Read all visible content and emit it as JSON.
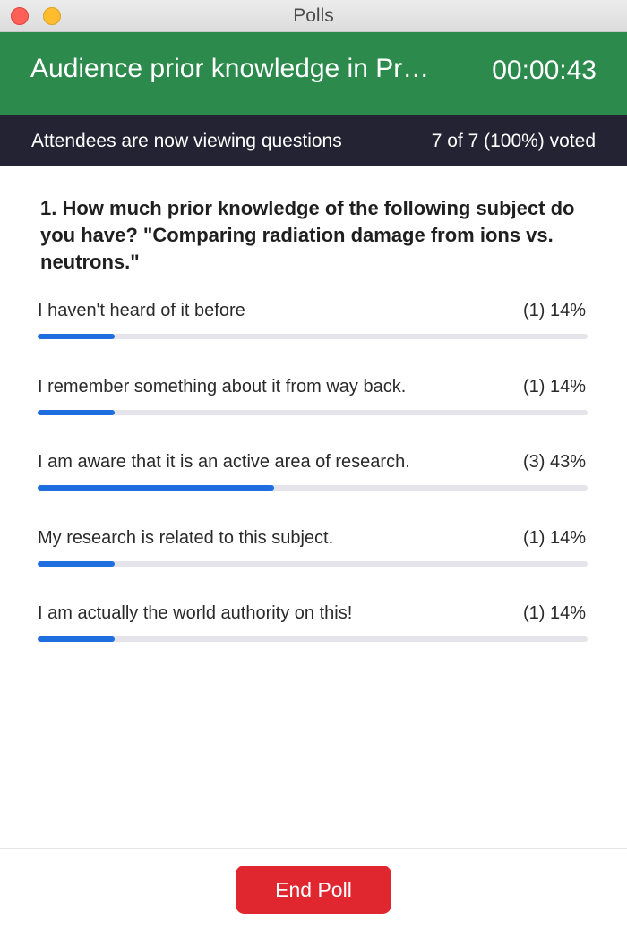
{
  "window": {
    "title": "Polls"
  },
  "header": {
    "poll_title": "Audience prior knowledge in Pr…",
    "timer": "00:00:43",
    "background_color": "#2b8a4c"
  },
  "status": {
    "viewing_text": "Attendees are now viewing questions",
    "voted_text": "7 of 7 (100%) voted"
  },
  "question": {
    "text": "1. How much prior knowledge of the following subject do you have? \"Comparing radiation damage from ions vs. neutrons.\""
  },
  "answers": [
    {
      "label": "I haven't heard of it before",
      "result": "(1) 14%",
      "percent": 14
    },
    {
      "label": "I remember something about it from way back.",
      "result": "(1) 14%",
      "percent": 14
    },
    {
      "label": "I am aware that it is an active area of research.",
      "result": "(3) 43%",
      "percent": 43
    },
    {
      "label": "My research is related to this subject.",
      "result": "(1) 14%",
      "percent": 14
    },
    {
      "label": "I am actually the world authority on this!",
      "result": "(1) 14%",
      "percent": 14
    }
  ],
  "footer": {
    "end_poll_label": "End Poll",
    "button_color": "#e0262f"
  },
  "colors": {
    "bar_fill": "#1e6ee0",
    "bar_track": "#e4e4ea",
    "status_bar": "#232333"
  }
}
